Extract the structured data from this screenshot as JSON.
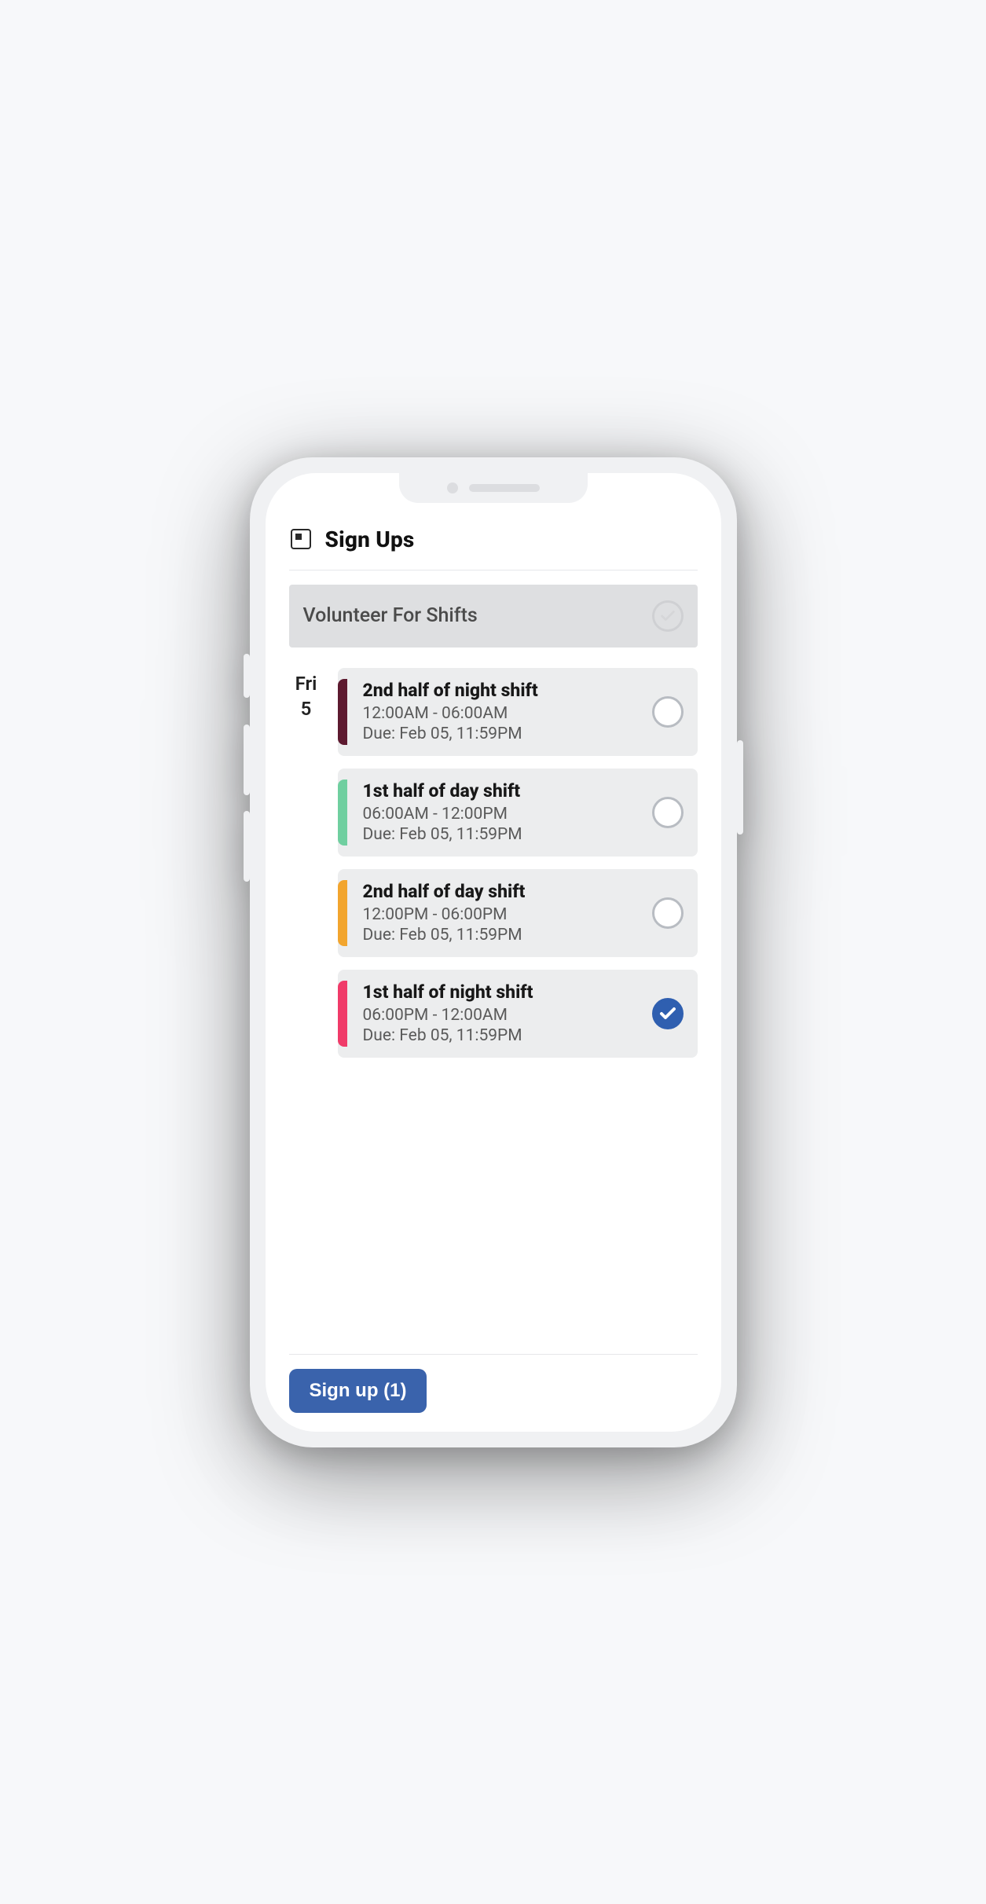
{
  "header": {
    "title": "Sign Ups"
  },
  "section": {
    "title": "Volunteer For Shifts"
  },
  "date": {
    "dow": "Fri",
    "day": "5"
  },
  "shifts": [
    {
      "title": "2nd half of night shift",
      "time": "12:00AM - 06:00AM",
      "due": "Due: Feb 05, 11:59PM",
      "color": "#5d1a2f",
      "selected": false
    },
    {
      "title": "1st half of day shift",
      "time": "06:00AM - 12:00PM",
      "due": "Due: Feb 05, 11:59PM",
      "color": "#70cfa0",
      "selected": false
    },
    {
      "title": "2nd half of day shift",
      "time": "12:00PM - 06:00PM",
      "due": "Due: Feb 05, 11:59PM",
      "color": "#f2a52e",
      "selected": false
    },
    {
      "title": "1st half of night shift",
      "time": "06:00PM - 12:00AM",
      "due": "Due: Feb 05, 11:59PM",
      "color": "#f03b69",
      "selected": true
    }
  ],
  "footer": {
    "button": "Sign up (1)"
  }
}
